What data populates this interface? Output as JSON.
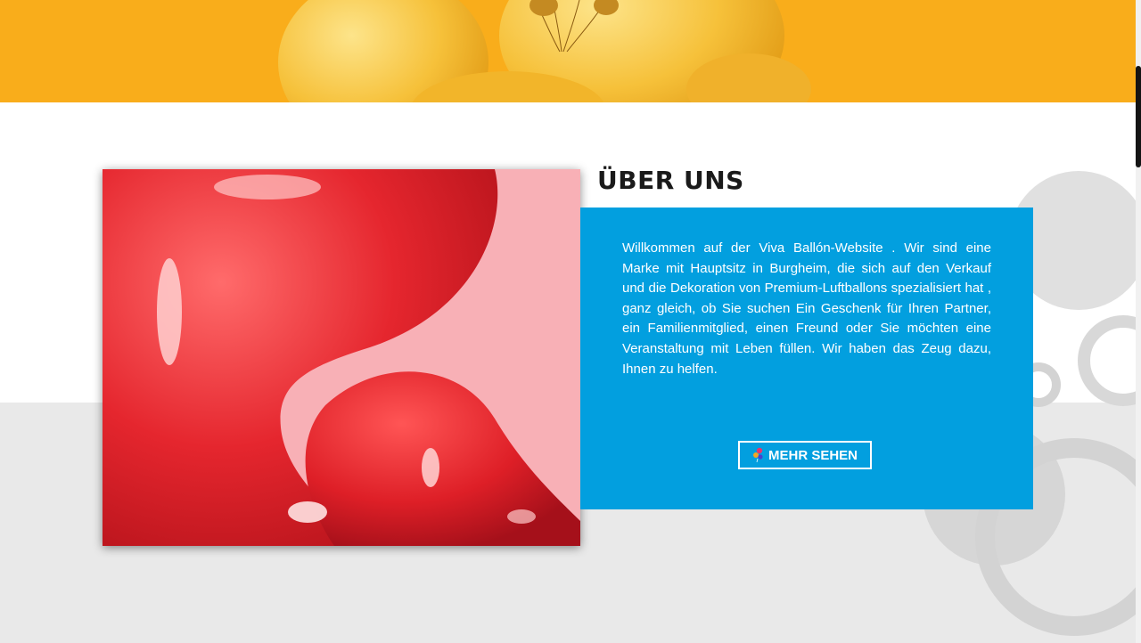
{
  "about": {
    "title": "ÜBER UNS",
    "text": "Willkommen auf der Viva Ballón-Website . Wir sind eine Marke mit Hauptsitz in Burgheim, die sich auf den Verkauf und die Dekoration von Premium-Luftballons spezialisiert hat , ganz gleich, ob Sie suchen Ein Geschenk für Ihren Partner, ein Familienmitglied, einen Freund oder Sie möchten eine Veranstaltung mit Leben füllen. Wir haben das Zeug dazu, Ihnen zu helfen.",
    "button_label": "MEHR SEHEN",
    "button_icon": "balloons-icon"
  },
  "colors": {
    "banner": "#f9ad1b",
    "info_box": "#029fdf",
    "title": "#1a1a1a",
    "lower_band": "#e9e9e9"
  }
}
